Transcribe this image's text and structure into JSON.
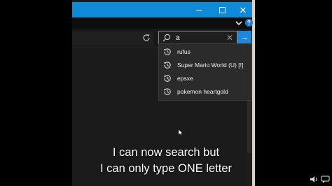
{
  "window": {
    "minimize_label": "",
    "maximize_label": "",
    "close_label": "✕"
  },
  "search": {
    "value": "a",
    "clear_label": "✕",
    "go_label": "→"
  },
  "suggestions": [
    {
      "label": "rufus"
    },
    {
      "label": "Super Mario World (U) [!]"
    },
    {
      "label": "epsxe"
    },
    {
      "label": "pokemon heartgold"
    }
  ],
  "caption": {
    "line1": "I can now search but",
    "line2": "I can only type ONE letter"
  },
  "help_label": "?",
  "colors": {
    "titlebar": "#0f8ad6",
    "accent": "#1f86d8",
    "window_bg": "#1b1b1b",
    "dropdown_bg": "#2b2b2b"
  }
}
